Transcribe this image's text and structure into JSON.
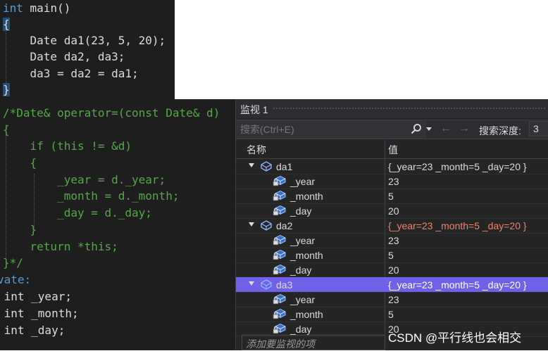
{
  "code_top": {
    "lines": [
      [
        "int",
        " main()"
      ],
      [
        "{",
        ""
      ],
      [
        "    Date da1(23, 5, 20);",
        ""
      ],
      [
        "    Date da2, da3;",
        ""
      ],
      [
        "    da3 = da2 = da1;",
        ""
      ],
      [
        "}",
        ""
      ]
    ]
  },
  "code_left": {
    "lines": [
      "/*Date& operator=(const Date& d)",
      "{",
      "    if (this != &d)",
      "    {",
      "        _year = d._year;",
      "        _month = d._month;",
      "        _day = d._day;",
      "    }",
      "    return *this;",
      "}*/",
      "vate:",
      " int _year;",
      " int _month;",
      " int _day;"
    ]
  },
  "watch": {
    "title": "监视 1",
    "search_placeholder": "搜索(Ctrl+E)",
    "search_depth_label": "搜索深度:",
    "search_depth_value": "3",
    "columns": {
      "name": "名称",
      "value": "值"
    },
    "rows": [
      {
        "name": "da1",
        "value": "{_year=23 _month=5 _day=20 }",
        "level": 0,
        "changed": false,
        "selected": false
      },
      {
        "name": "_year",
        "value": "23",
        "level": 1
      },
      {
        "name": "_month",
        "value": "5",
        "level": 1
      },
      {
        "name": "_day",
        "value": "20",
        "level": 1
      },
      {
        "name": "da2",
        "value": "{_year=23 _month=5 _day=20 }",
        "level": 0,
        "changed": true,
        "selected": false
      },
      {
        "name": "_year",
        "value": "23",
        "level": 1
      },
      {
        "name": "_month",
        "value": "5",
        "level": 1
      },
      {
        "name": "_day",
        "value": "20",
        "level": 1
      },
      {
        "name": "da3",
        "value": "{_year=23 _month=5 _day=20 }",
        "level": 0,
        "changed": true,
        "selected": true
      },
      {
        "name": "_year",
        "value": "23",
        "level": 1
      },
      {
        "name": "_month",
        "value": "5",
        "level": 1
      },
      {
        "name": "_day",
        "value": "20",
        "level": 1
      }
    ],
    "add_watch_placeholder": "添加要监视的项"
  },
  "watermark": "CSDN @平行线也会相交",
  "colors": {
    "editor_bg": "#1e1e1e",
    "keyword": "#569cd6",
    "comment": "#57a64a",
    "number": "#b5cea8",
    "changed_value": "#f08070",
    "selection": "#7160e8"
  }
}
